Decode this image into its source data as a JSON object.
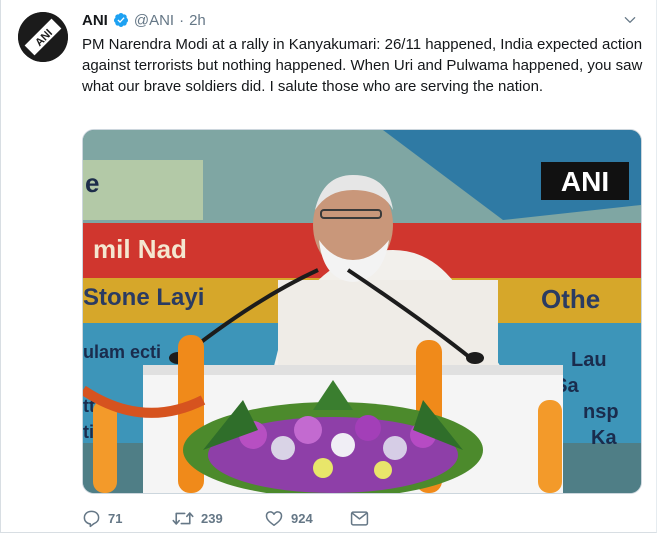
{
  "tweet": {
    "author_name": "ANI",
    "author_handle": "@ANI",
    "separator": "·",
    "time": "2h",
    "text": "PM Narendra Modi at a rally in Kanyakumari: 26/11 happened, India expected action against terrorists but nothing happened. When Uri and Pulwama happened, you saw what our brave soldiers did. I salute those who are serving the nation.",
    "avatar_logo": "ANI"
  },
  "media": {
    "watermark": "ANI",
    "banner_texts": [
      "e",
      "mil Nad",
      "Stone Layi",
      "Othe",
      "ulam ecti",
      "Lau",
      "oad Sa",
      "nsp",
      "Ka",
      "tt",
      "ti"
    ]
  },
  "actions": {
    "replies": "71",
    "retweets": "239",
    "likes": "924"
  },
  "icons": {
    "verified": "verified-badge-icon",
    "caret": "chevron-down-icon",
    "reply": "reply-icon",
    "retweet": "retweet-icon",
    "like": "heart-icon",
    "dm": "envelope-icon"
  },
  "colors": {
    "verified": "#1da1f2",
    "muted": "#657786",
    "text": "#14171a"
  }
}
